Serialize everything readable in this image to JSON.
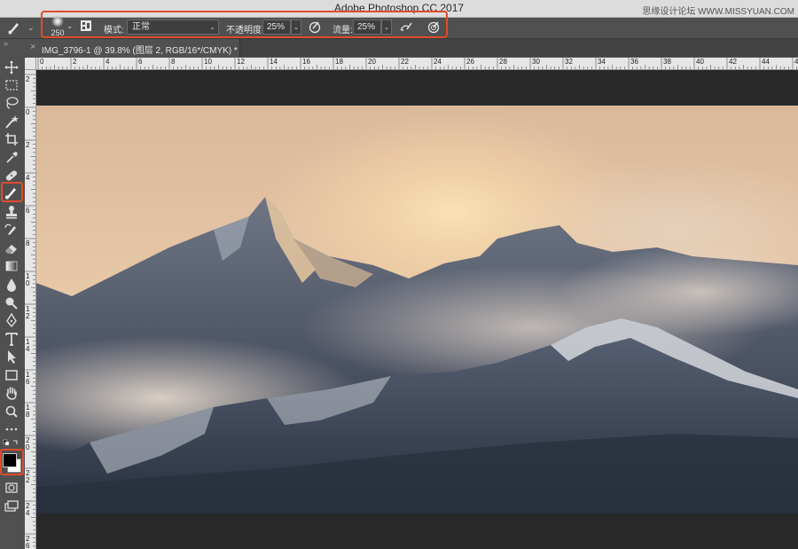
{
  "app": {
    "title": "Adobe Photoshop CC 2017",
    "watermark": "思缘设计论坛 WWW.MISSYUAN.COM"
  },
  "options_bar": {
    "brush_size": "250",
    "mode_label": "模式:",
    "mode_value": "正常",
    "opacity_label": "不透明度:",
    "opacity_value": "25%",
    "flow_label": "流量:",
    "flow_value": "25%"
  },
  "document_tab": {
    "close_glyph": "×",
    "title": "IMG_3796-1 @ 39.8% (图层 2, RGB/16*/CMYK) *"
  },
  "ruler": {
    "top_labels": [
      "0",
      "2",
      "4",
      "6",
      "8",
      "10",
      "12",
      "14",
      "16",
      "18",
      "20",
      "22",
      "24",
      "26",
      "28",
      "30",
      "32",
      "34",
      "36",
      "38",
      "40",
      "42",
      "44",
      "46"
    ],
    "left_labels": [
      "2",
      "0",
      "2",
      "4",
      "6",
      "8",
      "1\n0",
      "1\n2",
      "1\n4",
      "1\n6",
      "1\n8",
      "2\n0",
      "2\n2",
      "2\n4",
      "2\n6"
    ]
  },
  "tools": [
    "move-tool",
    "marquee-tool",
    "lasso-tool",
    "magic-wand-tool",
    "crop-tool",
    "eyedropper-tool",
    "healing-brush-tool",
    "brush-tool",
    "clone-stamp-tool",
    "history-brush-tool",
    "eraser-tool",
    "gradient-tool",
    "blur-tool",
    "dodge-tool",
    "pen-tool",
    "type-tool",
    "path-selection-tool",
    "rectangle-tool",
    "hand-tool",
    "zoom-tool",
    "more-tools"
  ],
  "colors": {
    "highlight": "#e14b2b",
    "foreground": "#000000",
    "background": "#ffffff"
  },
  "image": {
    "alt": "photo"
  }
}
